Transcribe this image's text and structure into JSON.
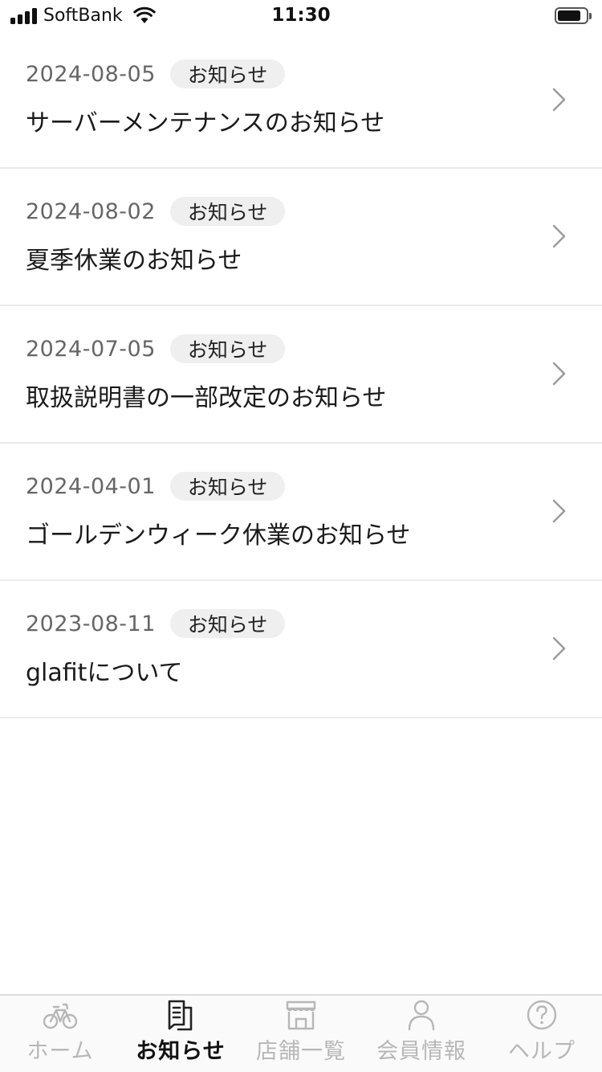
{
  "status_bar": {
    "carrier": "SoftBank",
    "time": "11:30"
  },
  "news": [
    {
      "date": "2024-08-05",
      "category": "お知らせ",
      "title": "サーバーメンテナンスのお知らせ"
    },
    {
      "date": "2024-08-02",
      "category": "お知らせ",
      "title": "夏季休業のお知らせ"
    },
    {
      "date": "2024-07-05",
      "category": "お知らせ",
      "title": "取扱説明書の一部改定のお知らせ"
    },
    {
      "date": "2024-04-01",
      "category": "お知らせ",
      "title": "ゴールデンウィーク休業のお知らせ"
    },
    {
      "date": "2023-08-11",
      "category": "お知らせ",
      "title": "glafitについて"
    }
  ],
  "tab_bar": {
    "active_tab": "news",
    "tabs": [
      {
        "id": "home",
        "label": "ホーム",
        "icon": "bicycle-icon"
      },
      {
        "id": "news",
        "label": "お知らせ",
        "icon": "document-icon"
      },
      {
        "id": "stores",
        "label": "店舗一覧",
        "icon": "store-icon"
      },
      {
        "id": "member",
        "label": "会員情報",
        "icon": "person-icon"
      },
      {
        "id": "help",
        "label": "ヘルプ",
        "icon": "help-icon"
      }
    ]
  },
  "colors": {
    "active_label": "#111111",
    "inactive_label": "#b7b7b7",
    "badge_background": "#efefef",
    "divider": "#ebebeb"
  }
}
